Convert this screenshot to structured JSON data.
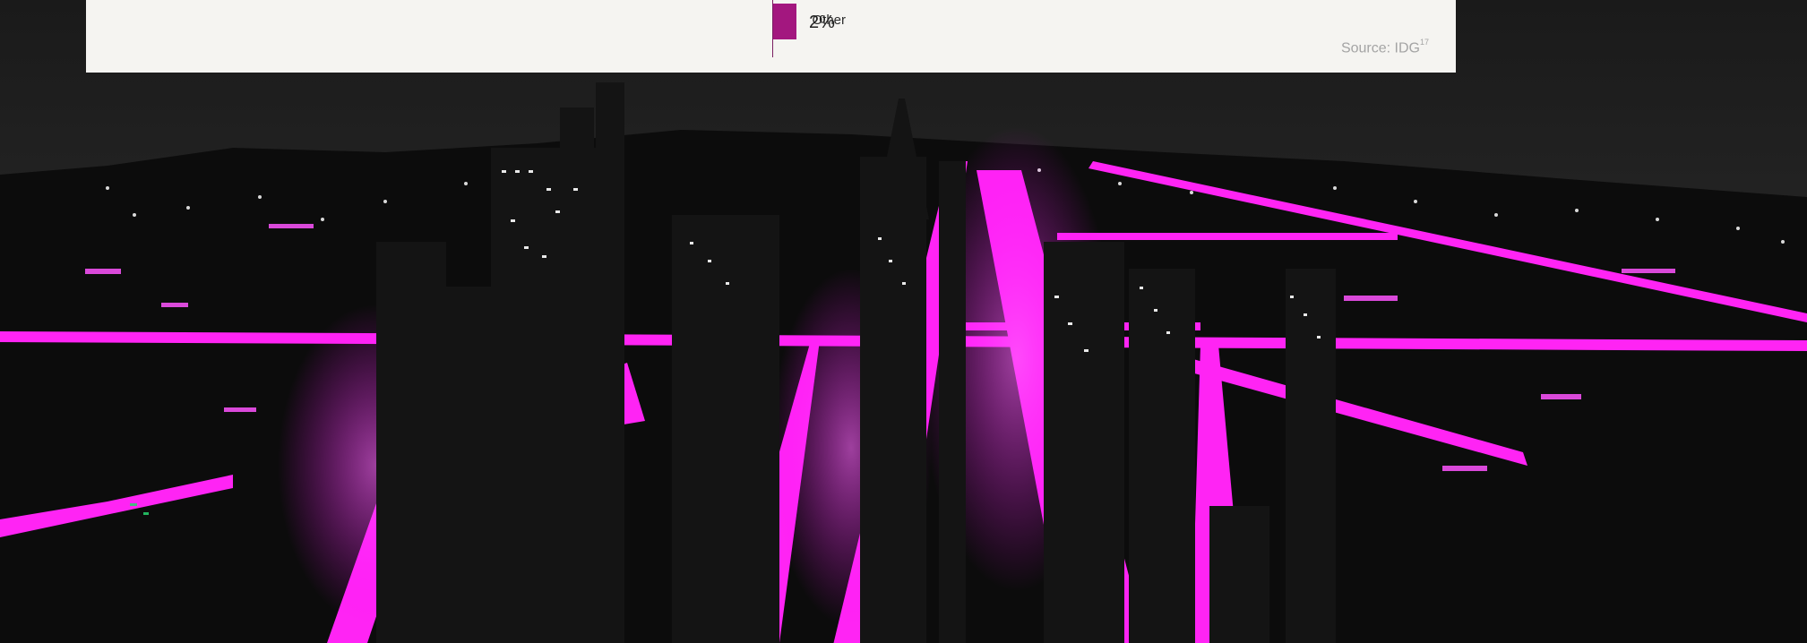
{
  "chart_data": {
    "type": "bar",
    "categories": [
      "Other"
    ],
    "values": [
      2
    ],
    "value_labels": [
      "2%"
    ],
    "unit": "%",
    "title": "",
    "xlabel": "",
    "ylabel": "",
    "xlim": [
      0,
      100
    ],
    "source_label": "Source: IDG",
    "source_note": "17",
    "colors": {
      "bar": "#a3177f",
      "axis": "#7a1e62",
      "card_background": "#f5f4f1"
    }
  },
  "background": {
    "icon": "night-city-photo",
    "accent": "#ff2bff",
    "base": "#101010"
  }
}
